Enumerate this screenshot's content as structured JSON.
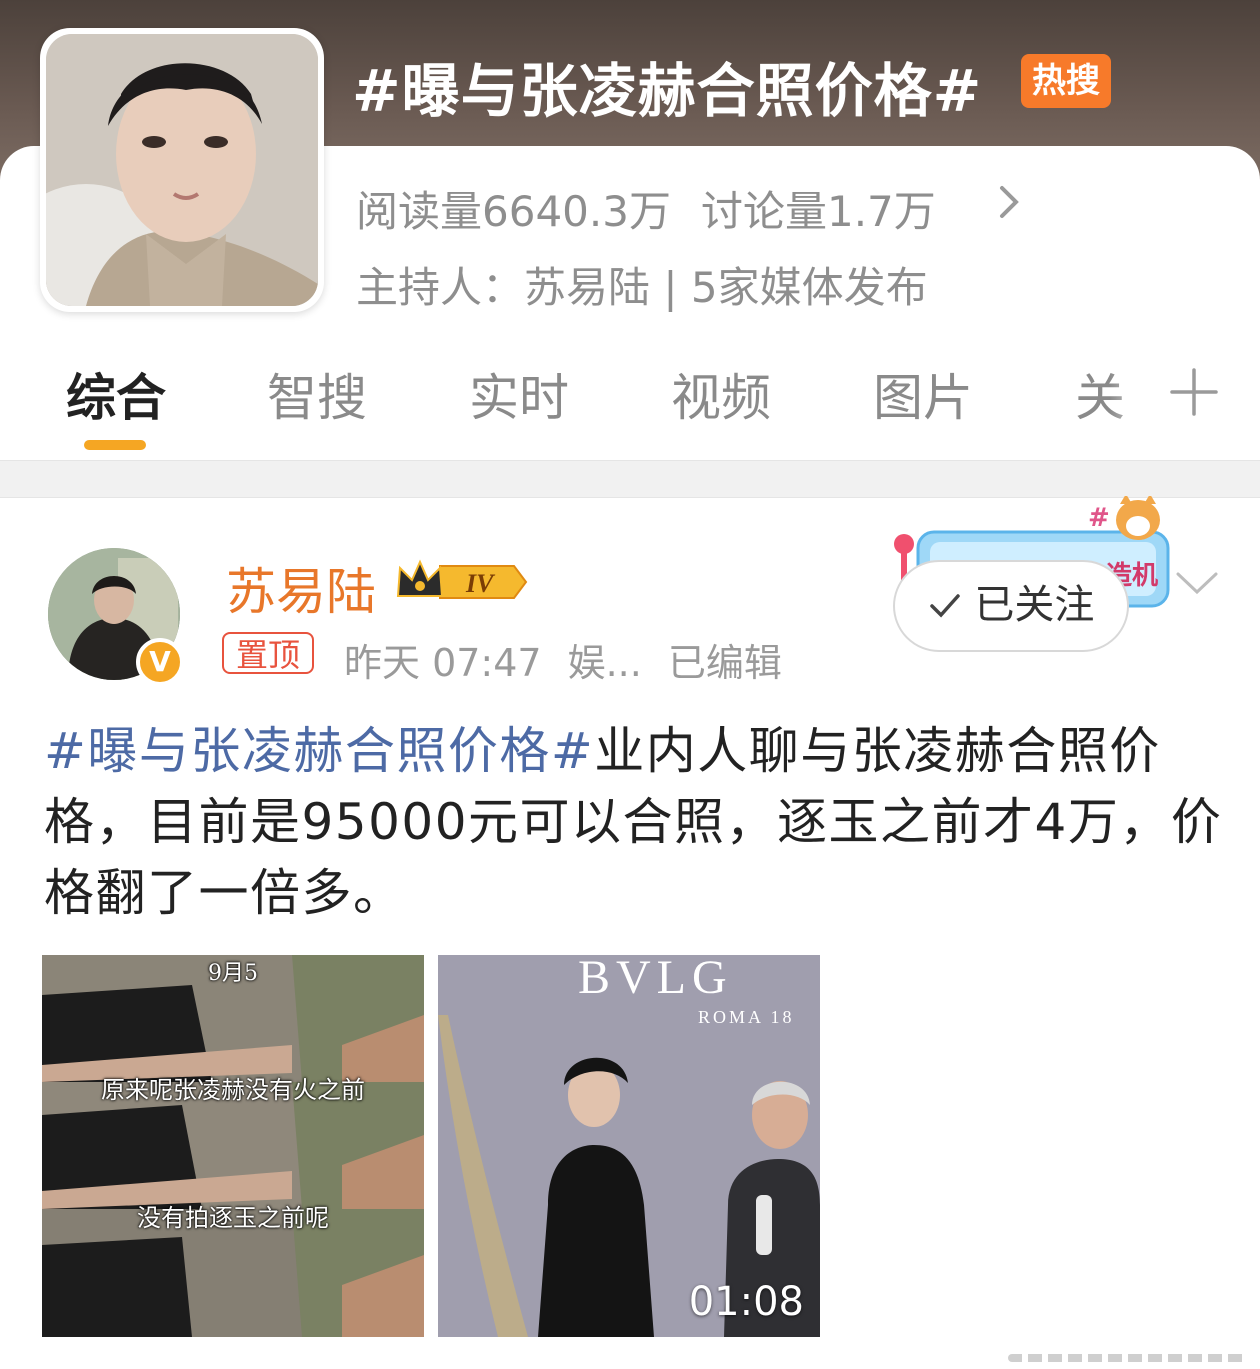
{
  "topic": {
    "title": "#曝与张凌赫合照价格#",
    "hot_badge": "热搜",
    "reads": "阅读量6640.3万",
    "discussions": "讨论量1.7万",
    "host_line": "主持人：苏易陆 | 5家媒体发布"
  },
  "tabs": [
    {
      "label": "综合",
      "active": true
    },
    {
      "label": "智搜"
    },
    {
      "label": "实时"
    },
    {
      "label": "视频"
    },
    {
      "label": "图片"
    },
    {
      "label": "关"
    }
  ],
  "post": {
    "author": "苏易陆",
    "level": "IV",
    "pinned_tag": "置顶",
    "time": "昨天 07:47",
    "category": "娱...",
    "edited": "已编辑",
    "follow_label": "已关注",
    "promo_text": "造机",
    "hashtag": "#曝与张凌赫合照价格#",
    "body": "业内人聊与张凌赫合照价格，目前是95000元可以合照，逐玉之前才4万，价格翻了一倍多。",
    "images": [
      {
        "date_overlay": "9月5",
        "captions": [
          "原来呢张凌赫没有火之前",
          "没有拍逐玉之前呢"
        ]
      },
      {
        "brand": "BVLG",
        "brand_sub": "ROMA 18",
        "video_duration": "01:08"
      }
    ]
  },
  "colors": {
    "accent_orange": "#f5a623",
    "author_orange": "#e8772a",
    "hashtag_blue": "#4d6aa5",
    "hot_badge": "#f77a2a",
    "pin_red": "#e8533e"
  }
}
